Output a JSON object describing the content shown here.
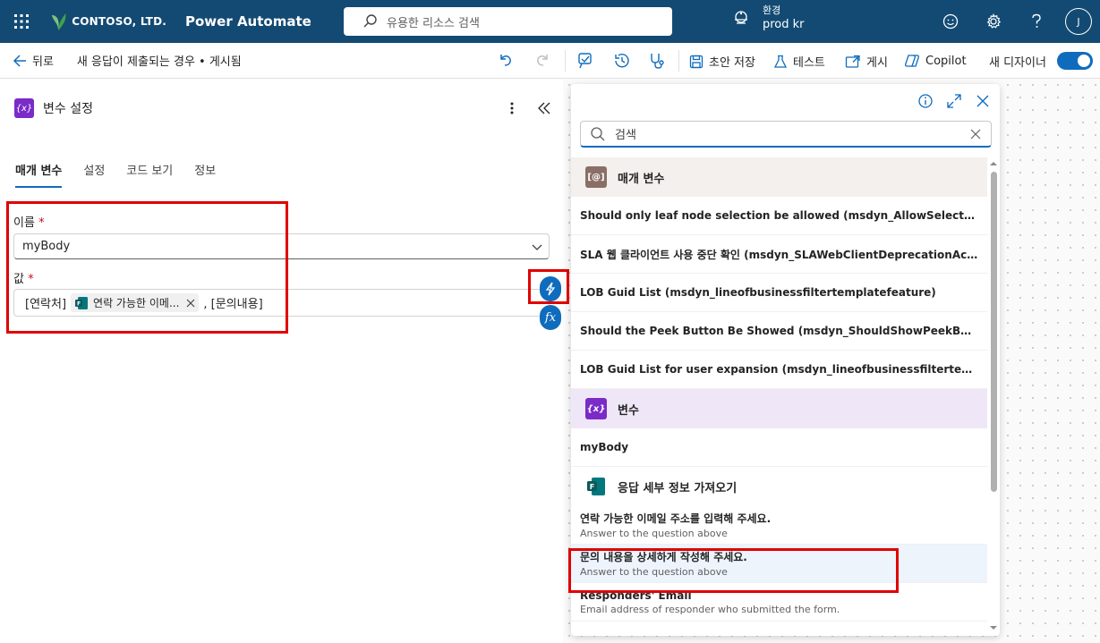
{
  "topbar": {
    "brand": "CONTOSO, LTD.",
    "app_name": "Power Automate",
    "search_placeholder": "유용한 리소스 검색",
    "env_label": "환경",
    "env_name": "prod kr",
    "avatar_initial": "J"
  },
  "cmdbar": {
    "back_label": "뒤로",
    "flow_title": "새 응답이 제출되는 경우 • 게시됨",
    "save_draft": "초안 저장",
    "test": "테스트",
    "publish": "게시",
    "copilot": "Copilot",
    "new_designer": "새 디자이너",
    "new_designer_on": true
  },
  "panel": {
    "title": "변수 설정",
    "tabs": [
      "매개 변수",
      "설정",
      "코드 보기",
      "정보"
    ],
    "name_label": "이름",
    "name_value": "myBody",
    "value_label": "값",
    "value_prefix": "[연락처]",
    "chip_label": "연락 가능한 이메...",
    "value_suffix": ", [문의내용]"
  },
  "popup": {
    "search_placeholder": "검색",
    "params_header": "매개 변수",
    "params_items": [
      "Should only leaf node selection be allowed (msdyn_AllowSelectLeafOnly)",
      "SLA 웹 클라이언트 사용 중단 확인 (msdyn_SLAWebClientDeprecationAcknowledge)",
      "LOB Guid List (msdyn_lineofbusinessfiltertemplatefeature)",
      "Should the Peek Button Be Showed (msdyn_ShouldShowPeekButton)",
      "LOB Guid List for user expansion (msdyn_lineofbusinessfiltertemplatefeatureuse..."
    ],
    "vars_header": "변수",
    "vars_items": [
      "myBody"
    ],
    "forms_header": "응답 세부 정보 가져오기",
    "forms_items": [
      {
        "title": "연락 가능한 이메일 주소를 입력해 주세요.",
        "sub": "Answer to the question above"
      },
      {
        "title": "문의 내용을 상세하게 작성해 주세요.",
        "sub": "Answer to the question above"
      },
      {
        "title": "Responders' Email",
        "sub": "Email address of responder who submitted the form."
      }
    ]
  },
  "colors": {
    "topbar_bg": "#134a73",
    "accent": "#0f6cbd",
    "variable_purple": "#7a2bc8",
    "highlight_red": "#e00000"
  }
}
